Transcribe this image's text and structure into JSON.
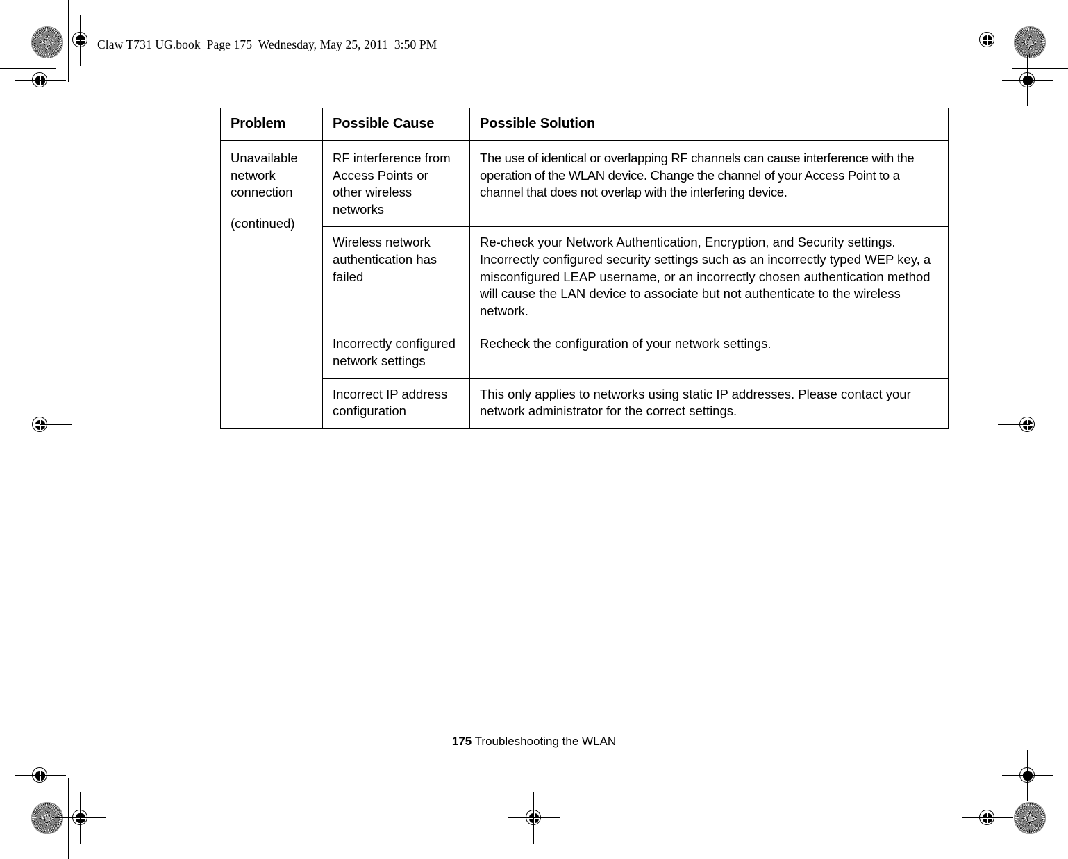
{
  "page": {
    "header_slug": "Claw T731 UG.book  Page 175  Wednesday, May 25, 2011  3:50 PM",
    "footer_page_number": "175",
    "footer_section_title": "Troubleshooting the WLAN",
    "ink_color": "#000000",
    "background_color": "#ffffff"
  },
  "table": {
    "headers": {
      "problem": "Problem",
      "possible_cause": "Possible Cause",
      "possible_solution": "Possible Solution"
    },
    "problem": {
      "title": "Unavailable network connection",
      "continued_note": "(continued)"
    },
    "rows": [
      {
        "cause": "RF interference from Access Points or other wireless networks",
        "solution": "The use of identical or overlapping RF channels can cause interference with the operation of the WLAN device. Change the channel of your Access Point to a channel that does not overlap with the interfering device."
      },
      {
        "cause": "Wireless network authentication has failed",
        "solution": "Re-check your Network Authentication, Encryption, and Security settings. Incorrectly configured security settings such as an incorrectly typed WEP key, a misconfigured LEAP username, or an incorrectly chosen authentication method will cause the LAN device to associate but not authenticate to the wireless network."
      },
      {
        "cause": "Incorrectly configured network settings",
        "solution": "Recheck the configuration of your network settings."
      },
      {
        "cause": "Incorrect IP address configuration",
        "solution": "This only applies to networks using static IP addresses. Please contact your network administrator for the correct settings."
      }
    ]
  }
}
